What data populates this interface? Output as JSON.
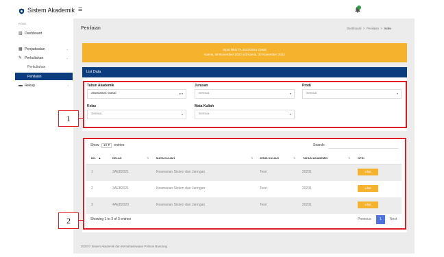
{
  "app": {
    "title": "Sistem Akademik",
    "hamburger_glyph": "≡",
    "logo_icon": "shield-icon",
    "bell_icon": "bell-icon"
  },
  "sidebar": {
    "heading": "HOME",
    "items": [
      {
        "label": "Dashboard",
        "icon": "chart-icon",
        "glyph": "▥"
      },
      {
        "label": "Penjadwalan",
        "icon": "calendar-icon",
        "glyph": "▦",
        "chevron": "⌄"
      },
      {
        "label": "Perkuliahan",
        "icon": "pencil-icon",
        "glyph": "✎",
        "chevron": "⌄"
      },
      {
        "label": "Perkuliahan",
        "sub": true
      },
      {
        "label": "Penilaian",
        "sub": true,
        "active": true
      },
      {
        "label": "Rekap",
        "icon": "list-icon",
        "glyph": "▬",
        "chevron": "›"
      }
    ]
  },
  "header": {
    "page_title": "Penilaian",
    "breadcrumb": [
      "Dashboard",
      "Penilaian",
      "Index"
    ],
    "separator": ">"
  },
  "notice": {
    "line1": "Input Nilai TA 2023/2024 Gasal",
    "line2": "Kamis, 09 November 2023 s/d Kamis, 30 November 2023",
    "color": "#f5b32d"
  },
  "list_header": "List Data",
  "filters": {
    "tahun_akademik": {
      "label": "Tahun Akademik",
      "value": "2023/2024 Gasal"
    },
    "jurusan": {
      "label": "Jurusan",
      "value": "Semua"
    },
    "prodi": {
      "label": "Prodi",
      "value": "Semua"
    },
    "kelas": {
      "label": "Kelas",
      "value": "Semua"
    },
    "mata_kuliah": {
      "label": "Mata Kuliah",
      "value": "Semua"
    }
  },
  "table": {
    "show_label": "Show",
    "show_value": "10",
    "entries_label": "entries",
    "search_label": "Search:",
    "columns": [
      "NO.",
      "KELAS",
      "MATA KULIAH",
      "JENIS KULIAH",
      "TAHUN AKADEMIK",
      "OPSI"
    ],
    "rows": [
      {
        "no": "1",
        "kelas": "3AEB2021",
        "mata_kuliah": "Keamanan Sistem dan Jaringan",
        "jenis": "Teori",
        "tahun": "20231",
        "opsi": "Lihat"
      },
      {
        "no": "2",
        "kelas": "3AEB2021",
        "mata_kuliah": "Keamanan Sistem dan Jaringan",
        "jenis": "Teori",
        "tahun": "20231",
        "opsi": "Lihat"
      },
      {
        "no": "3",
        "kelas": "4AEB2020",
        "mata_kuliah": "Keamanan Sistem dan Jaringan",
        "jenis": "Teori",
        "tahun": "20231",
        "opsi": "Lihat"
      }
    ],
    "info": "Showing 1 to 3 of 3 entries",
    "pagination": {
      "prev": "Previous",
      "current": "1",
      "next": "Next"
    }
  },
  "footer": "2023 © Sistem Akademik dan Kemahasiswaan Polman Bandung",
  "annotations": {
    "box1": "1",
    "box2": "2",
    "color": "#e31b23"
  },
  "colors": {
    "primary": "#0b3c7e",
    "warning": "#f5b32d",
    "page_link": "#4e73df"
  }
}
